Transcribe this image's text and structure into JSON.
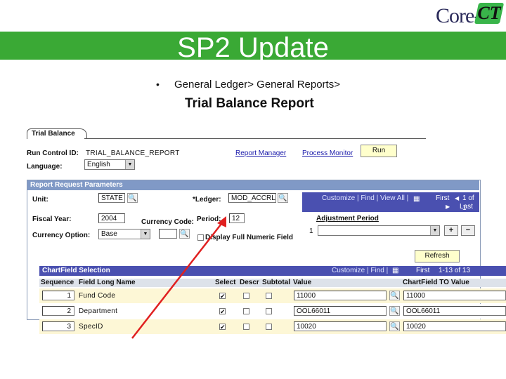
{
  "logo": {
    "text": "Core-",
    "ct": "CT"
  },
  "banner": {
    "title": "SP2 Update"
  },
  "bullet": {
    "dot": "•",
    "breadcrumb": "General Ledger> General Reports>"
  },
  "report_title": "Trial Balance Report",
  "tab": {
    "label": "Trial Balance"
  },
  "run_control": {
    "label": "Run Control ID:",
    "value": "TRIAL_BALANCE_REPORT"
  },
  "links": {
    "report_manager": "Report Manager",
    "process_monitor": "Process Monitor"
  },
  "run_button": "Run",
  "language": {
    "label": "Language:",
    "value": "English"
  },
  "params": {
    "header": "Report Request Parameters",
    "unit_label": "Unit:",
    "unit_value": "STATE",
    "ledger_label": "*Ledger:",
    "ledger_value": "MOD_ACCRL",
    "fiscal_year_label": "Fiscal Year:",
    "fiscal_year_value": "2004",
    "currency_code_label": "Currency Code:",
    "period_label": "Period:",
    "period_value": "12",
    "currency_option_label": "Currency Option:",
    "currency_option_value": "Base",
    "display_full_numeric": "Display Full Numeric Field"
  },
  "adjustment": {
    "nav": "Customize | Find | View All |",
    "first": "First",
    "count": "1 of 1",
    "last": "Last",
    "column": "Adjustment Period",
    "row_num": "1"
  },
  "refresh_button": "Refresh",
  "chartfield": {
    "header": "ChartField Selection",
    "nav": "Customize | Find |",
    "first": "First",
    "count": "1-13 of 13",
    "columns": {
      "sequence": "Sequence",
      "field_long_name": "Field Long Name",
      "select": "Select",
      "descr": "Descr",
      "subtotal": "Subtotal",
      "value": "Value",
      "to_value": "ChartField TO Value"
    },
    "rows": [
      {
        "seq": "1",
        "name": "Fund Code",
        "value": "11000",
        "to_value": "11000"
      },
      {
        "seq": "2",
        "name": "Department",
        "value": "OOL66011",
        "to_value": "OOL66011"
      },
      {
        "seq": "3",
        "name": "SpecID",
        "value": "10020",
        "to_value": "10020"
      }
    ]
  },
  "colors": {
    "banner": "#3aa935",
    "section_header": "#8099c6",
    "grid_header": "#4a50b0",
    "arrow": "#e02020"
  }
}
